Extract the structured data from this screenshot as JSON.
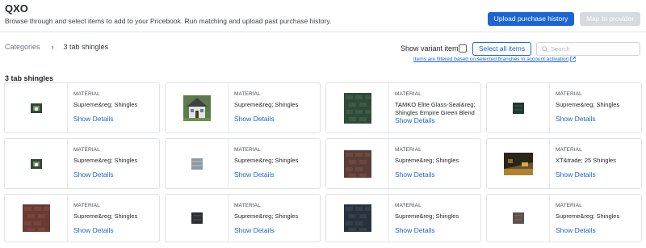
{
  "header": {
    "title": "QXO",
    "subtitle": "Browse through and select items to add to your Pricebook. Run matching and upload past purchase history.",
    "upload_label": "Upload purchase history",
    "map_label": "Map to provider"
  },
  "breadcrumb": {
    "root": "Categories",
    "separator": "›",
    "current": "3 tab shingles"
  },
  "toolbar": {
    "variant_label": "Show variant items",
    "select_all_label": "Select all items",
    "search_placeholder": "Search",
    "filter_note": "Items are filtered based on selected branches in account activation"
  },
  "section": {
    "title": "3 tab shingles"
  },
  "colors": {
    "accent": "#1d63d8",
    "disabled": "#d6d9de"
  },
  "products": [
    {
      "category": "MATERIAL",
      "name": "Supreme&reg; Shingles",
      "details": "Show Details",
      "image": "small-roof-thumbnail"
    },
    {
      "category": "MATERIAL",
      "name": "Supreme&reg; Shingles",
      "details": "Show Details",
      "image": "house-roof-photo"
    },
    {
      "category": "MATERIAL",
      "name": "TAMKO Elite Glass-Seal&reg; Shingles Empire Green Blend",
      "details": "Show Details",
      "image": "green-shingle-swatch"
    },
    {
      "category": "MATERIAL",
      "name": "Supreme&reg; Shingles",
      "details": "Show Details",
      "image": "dark-green-swatch"
    },
    {
      "category": "MATERIAL",
      "name": "Supreme&reg; Shingles",
      "details": "Show Details",
      "image": "small-roof-thumbnail"
    },
    {
      "category": "MATERIAL",
      "name": "Supreme&reg; Shingles",
      "details": "Show Details",
      "image": "gray-swatch"
    },
    {
      "category": "MATERIAL",
      "name": "Supreme&reg; Shingles",
      "details": "Show Details",
      "image": "brown-shingle-swatch"
    },
    {
      "category": "MATERIAL",
      "name": "XT&trade; 25 Shingles",
      "details": "Show Details",
      "image": "roof-installation-photo"
    },
    {
      "category": "MATERIAL",
      "name": "Supreme&reg; Shingles",
      "details": "Show Details",
      "image": "red-brown-shingle-swatch"
    },
    {
      "category": "MATERIAL",
      "name": "Supreme&reg; Shingles",
      "details": "Show Details",
      "image": "charcoal-swatch"
    },
    {
      "category": "MATERIAL",
      "name": "Supreme&reg; Shingles",
      "details": "Show Details",
      "image": "slate-blue-swatch"
    },
    {
      "category": "MATERIAL",
      "name": "Supreme&reg; Shingles",
      "details": "Show Details",
      "image": "brown-gray-swatch"
    }
  ]
}
